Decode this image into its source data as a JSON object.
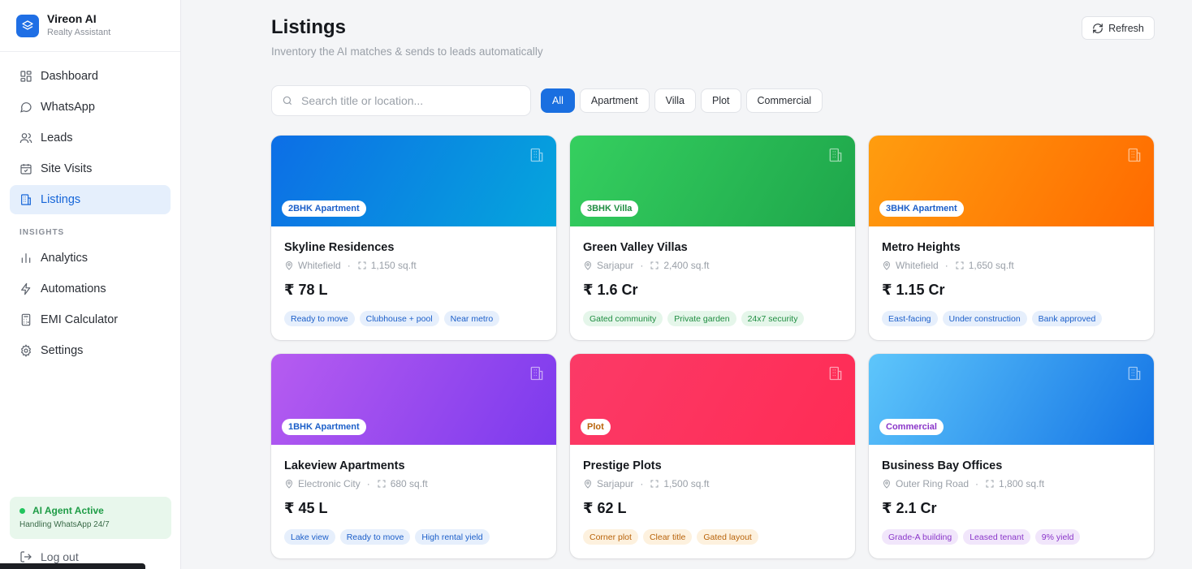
{
  "brand": {
    "name": "Vireon AI",
    "subtitle": "Realty Assistant"
  },
  "nav": {
    "items": [
      {
        "label": "Dashboard",
        "icon": "grid-icon"
      },
      {
        "label": "WhatsApp",
        "icon": "chat-bubble-icon"
      },
      {
        "label": "Leads",
        "icon": "users-icon"
      },
      {
        "label": "Site Visits",
        "icon": "calendar-check-icon"
      },
      {
        "label": "Listings",
        "icon": "building-icon",
        "active": true
      }
    ],
    "section": "INSIGHTS",
    "insights": [
      {
        "label": "Analytics",
        "icon": "bar-chart-icon"
      },
      {
        "label": "Automations",
        "icon": "lightning-icon"
      },
      {
        "label": "EMI Calculator",
        "icon": "calculator-icon"
      },
      {
        "label": "Settings",
        "icon": "gear-icon"
      }
    ]
  },
  "agent": {
    "title": "AI Agent Active",
    "subtitle": "Handling WhatsApp 24/7",
    "status_color": "#22c55e"
  },
  "logout_label": "Log out",
  "header": {
    "title": "Listings",
    "subtitle": "Inventory the AI matches & sends to leads automatically",
    "refresh_label": "Refresh"
  },
  "search": {
    "placeholder": "Search title or location...",
    "value": ""
  },
  "filters": [
    "All",
    "Apartment",
    "Villa",
    "Plot",
    "Commercial"
  ],
  "active_filter": "All",
  "colors": {
    "accent": "#1a6fe0"
  },
  "listings": [
    {
      "tag": "2BHK Apartment",
      "title": "Skyline Residences",
      "location": "Whitefield",
      "area": "1,150 sq.ft",
      "price": "₹ 78 L",
      "features": [
        "Ready to move",
        "Clubhouse + pool",
        "Near metro"
      ],
      "theme": "blue"
    },
    {
      "tag": "3BHK Villa",
      "title": "Green Valley Villas",
      "location": "Sarjapur",
      "area": "2,400 sq.ft",
      "price": "₹ 1.6 Cr",
      "features": [
        "Gated community",
        "Private garden",
        "24x7 security"
      ],
      "theme": "green"
    },
    {
      "tag": "3BHK Apartment",
      "title": "Metro Heights",
      "location": "Whitefield",
      "area": "1,650 sq.ft",
      "price": "₹ 1.15 Cr",
      "features": [
        "East-facing",
        "Under construction",
        "Bank approved"
      ],
      "theme": "orange"
    },
    {
      "tag": "1BHK Apartment",
      "title": "Lakeview Apartments",
      "location": "Electronic City",
      "area": "680 sq.ft",
      "price": "₹ 45 L",
      "features": [
        "Lake view",
        "Ready to move",
        "High rental yield"
      ],
      "theme": "purple"
    },
    {
      "tag": "Plot",
      "title": "Prestige Plots",
      "location": "Sarjapur",
      "area": "1,500 sq.ft",
      "price": "₹ 62 L",
      "features": [
        "Corner plot",
        "Clear title",
        "Gated layout"
      ],
      "theme": "red"
    },
    {
      "tag": "Commercial",
      "title": "Business Bay Offices",
      "location": "Outer Ring Road",
      "area": "1,800 sq.ft",
      "price": "₹ 2.1 Cr",
      "features": [
        "Grade-A building",
        "Leased tenant",
        "9% yield"
      ],
      "theme": "sky"
    }
  ]
}
